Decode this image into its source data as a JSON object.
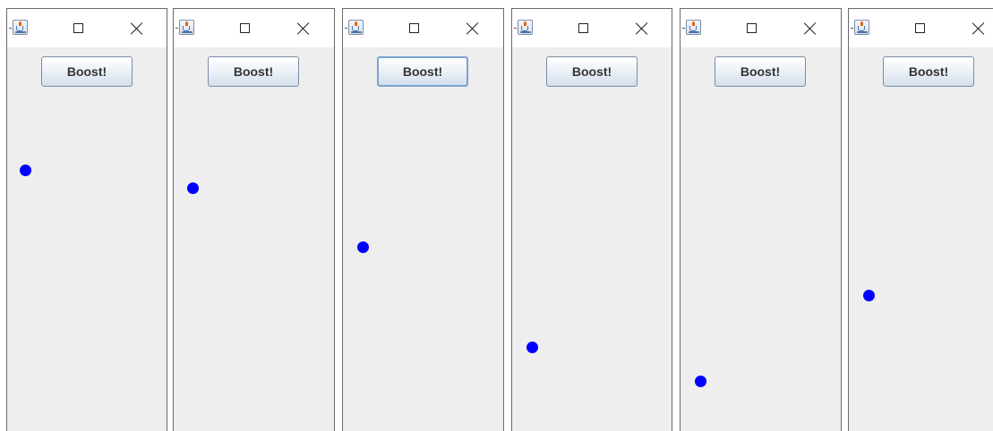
{
  "windows": [
    {
      "button_label": "Boost!",
      "focused": false,
      "ball_color": "#0000ff"
    },
    {
      "button_label": "Boost!",
      "focused": false,
      "ball_color": "#0000ff"
    },
    {
      "button_label": "Boost!",
      "focused": true,
      "ball_color": "#0000ff"
    },
    {
      "button_label": "Boost!",
      "focused": false,
      "ball_color": "#0000ff"
    },
    {
      "button_label": "Boost!",
      "focused": false,
      "ball_color": "#0000ff"
    },
    {
      "button_label": "Boost!",
      "focused": false,
      "ball_color": "#0000ff"
    }
  ],
  "icons": {
    "app": "java-cup-icon",
    "maximize": "maximize-icon",
    "close": "close-icon"
  }
}
